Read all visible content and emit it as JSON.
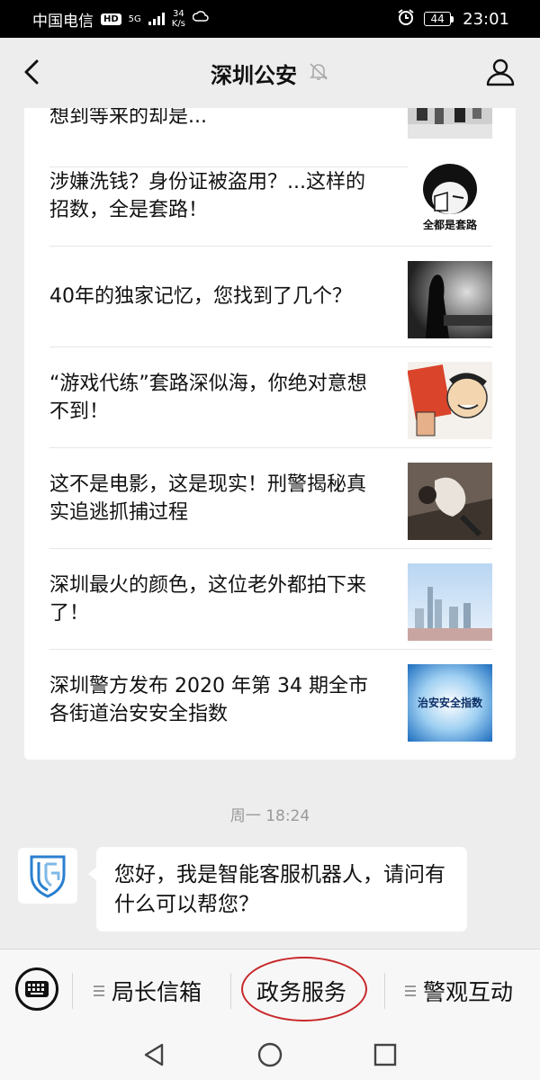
{
  "status_bar": {
    "carrier": "中国电信",
    "hd": "HD",
    "network": "5G",
    "speed_value": "34",
    "speed_unit": "K/s",
    "battery": "44",
    "time": "23:01"
  },
  "header": {
    "title": "深圳公安"
  },
  "articles": [
    {
      "title": "想到等来的却是..."
    },
    {
      "title": "涉嫌洗钱？身份证被盗用？...这样的招数，全是套路！",
      "thumb_caption": "全都是套路"
    },
    {
      "title": "40年的独家记忆，您找到了几个？"
    },
    {
      "title": "“游戏代练”套路深似海，你绝对意想不到！"
    },
    {
      "title": "这不是电影，这是现实！刑警揭秘真实追逃抓捕过程"
    },
    {
      "title": "深圳最火的颜色，这位老外都拍下来了！"
    },
    {
      "title": "深圳警方发布 2020 年第 34 期全市各街道治安安全指数",
      "thumb_caption": "治安安全指数"
    }
  ],
  "chat": {
    "timestamp": "周一 18:24",
    "message": "您好，我是智能客服机器人，请问有什么可以帮您？"
  },
  "menu": {
    "items": [
      {
        "label": "局长信箱"
      },
      {
        "label": "政务服务"
      },
      {
        "label": "警观互动"
      }
    ]
  },
  "colors": {
    "annotation_circle": "#c8272a",
    "logo_blue": "#2a7fd0"
  }
}
